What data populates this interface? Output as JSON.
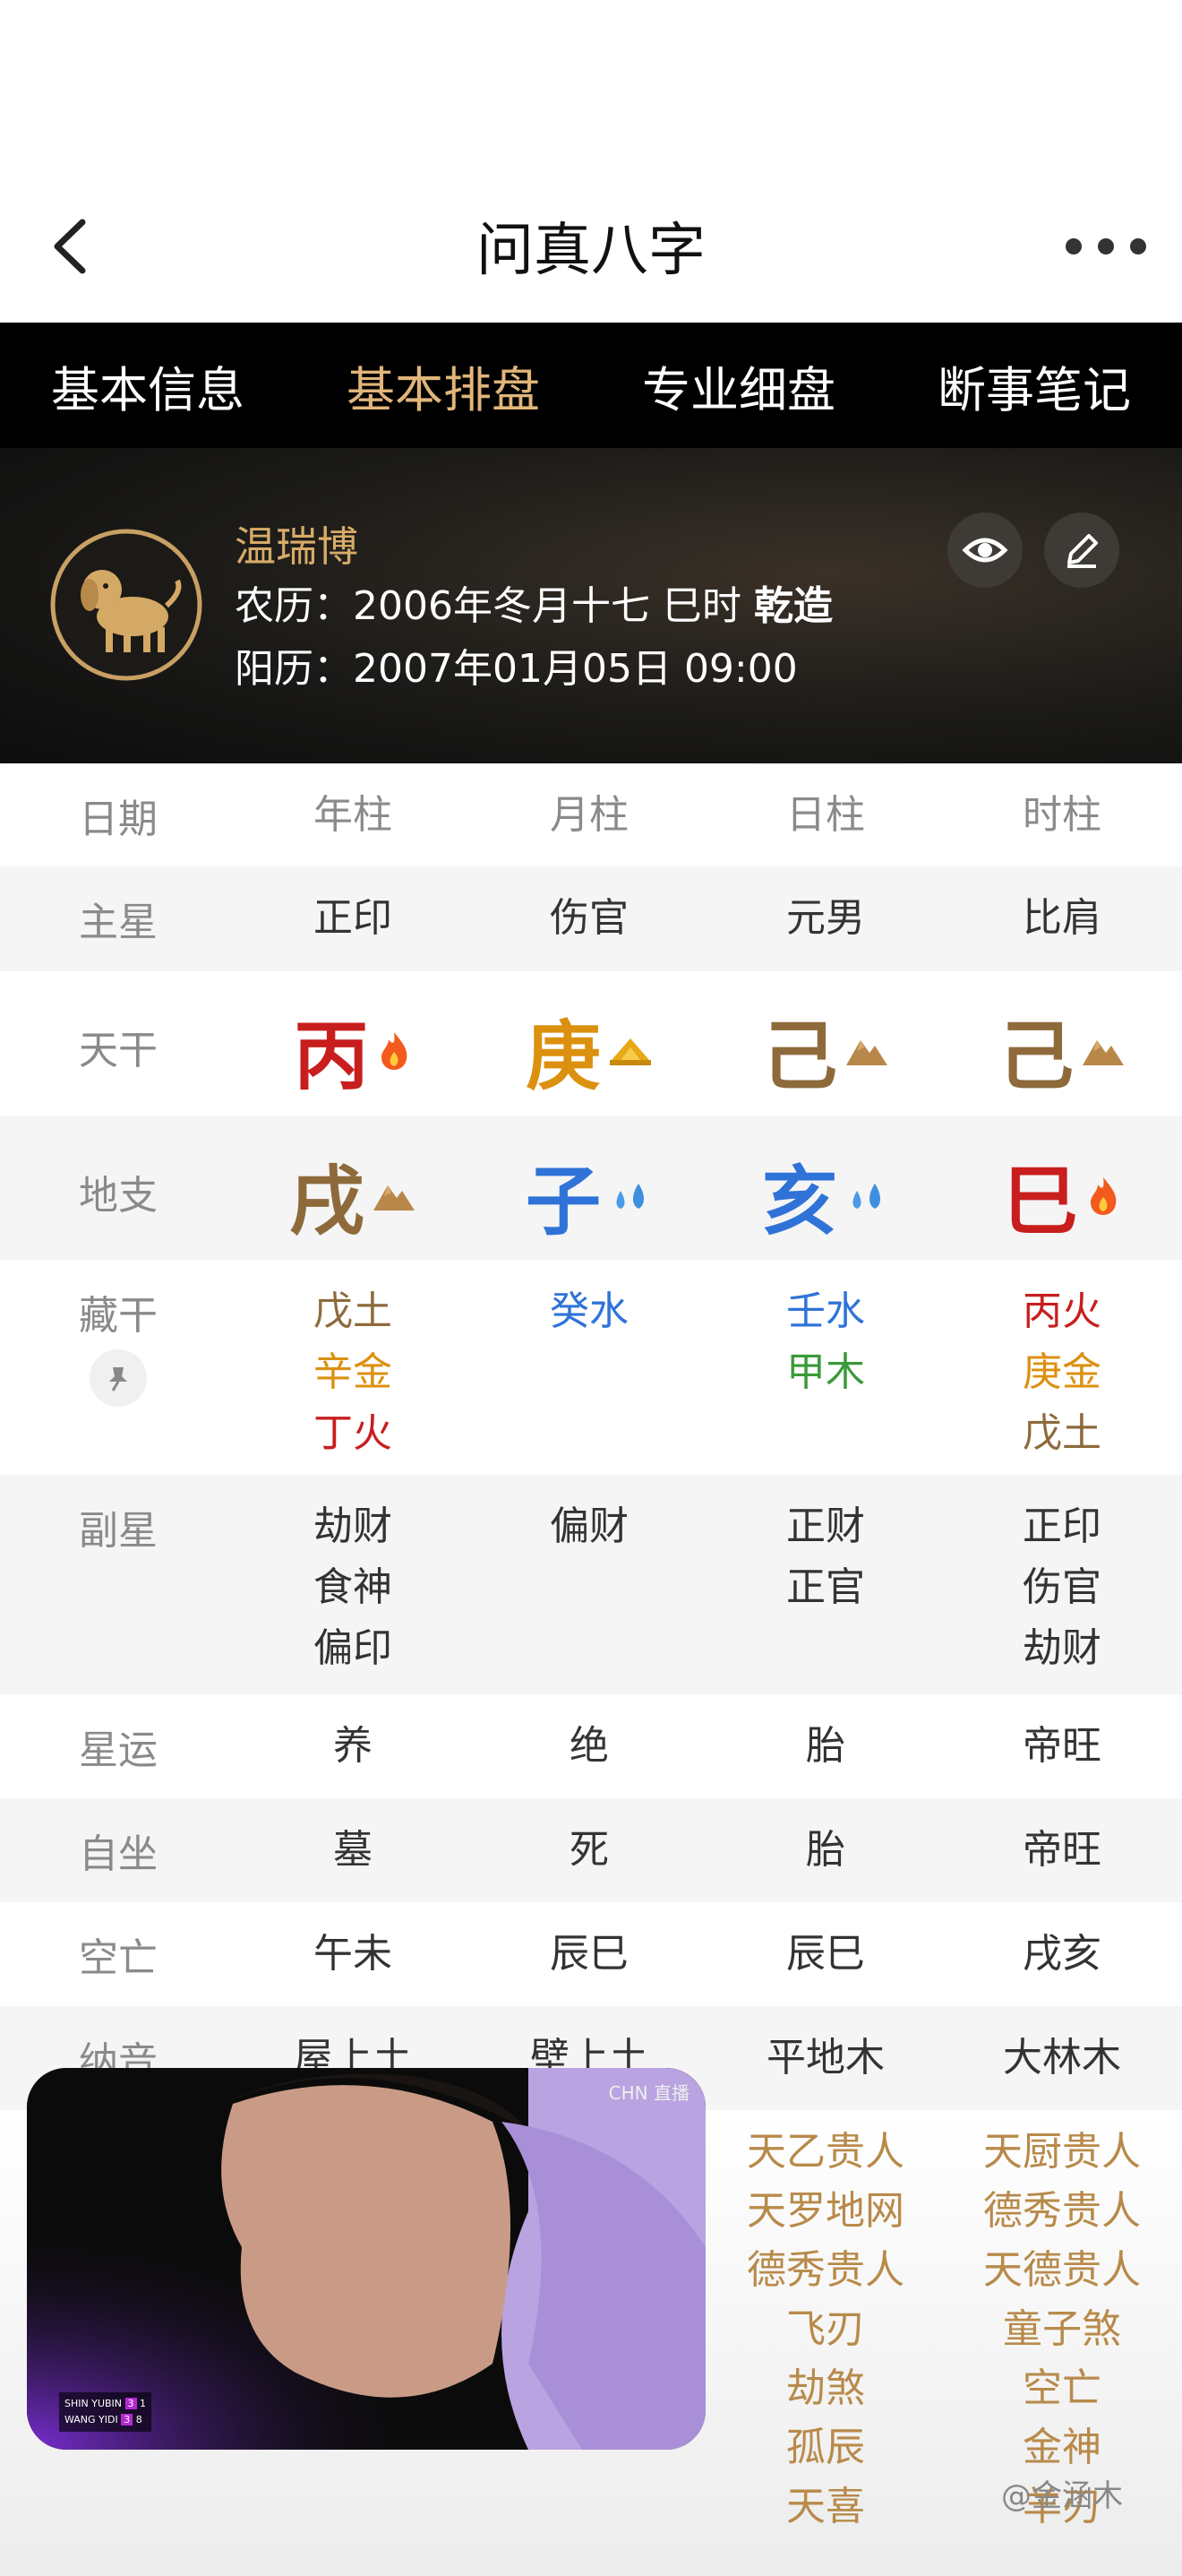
{
  "nav": {
    "title": "问真八字"
  },
  "tabs": [
    {
      "label": "基本信息"
    },
    {
      "label": "基本排盘"
    },
    {
      "label": "专业细盘"
    },
    {
      "label": "断事笔记"
    }
  ],
  "profile": {
    "name": "温瑞博",
    "lunar_label": "农历：",
    "lunar": "2006年冬月十七 巳时",
    "gender_tag": "乾造",
    "solar_label": "阳历：",
    "solar": "2007年01月05日 09:00"
  },
  "table": {
    "header": [
      "日期",
      "年柱",
      "月柱",
      "日柱",
      "时柱"
    ],
    "zhuxing": {
      "label": "主星",
      "values": [
        "正印",
        "伤官",
        "元男",
        "比肩"
      ]
    },
    "tiangan": {
      "label": "天干",
      "values": [
        "丙",
        "庚",
        "己",
        "己"
      ]
    },
    "dizhi": {
      "label": "地支",
      "values": [
        "戌",
        "子",
        "亥",
        "巳"
      ]
    },
    "canggan": {
      "label": "藏干",
      "year": [
        "戊土",
        "辛金",
        "丁火"
      ],
      "month": [
        "癸水"
      ],
      "day": [
        "壬水",
        "甲木"
      ],
      "hour": [
        "丙火",
        "庚金",
        "戊土"
      ]
    },
    "fuxing": {
      "label": "副星",
      "year": [
        "劫财",
        "食神",
        "偏印"
      ],
      "month": [
        "偏财"
      ],
      "day": [
        "正财",
        "正官"
      ],
      "hour": [
        "正印",
        "伤官",
        "劫财"
      ]
    },
    "xingyun": {
      "label": "星运",
      "values": [
        "养",
        "绝",
        "胎",
        "帝旺"
      ]
    },
    "zizuo": {
      "label": "自坐",
      "values": [
        "墓",
        "死",
        "胎",
        "帝旺"
      ]
    },
    "kongwang": {
      "label": "空亡",
      "values": [
        "午未",
        "辰巳",
        "辰巳",
        "戌亥"
      ]
    },
    "nayin": {
      "label": "纳音",
      "values": [
        "屋上土",
        "壁上土",
        "平地木",
        "大林木"
      ]
    },
    "shensha": {
      "day": [
        "天乙贵人",
        "天罗地网",
        "德秀贵人",
        "飞刃",
        "劫煞",
        "孤辰",
        "天喜"
      ],
      "hour": [
        "天厨贵人",
        "德秀贵人",
        "天德贵人",
        "童子煞",
        "空亡",
        "金神",
        "羊刃"
      ]
    }
  },
  "video": {
    "badge": "CHN 直播",
    "p1": "SHIN YUBIN",
    "p1_score": "3",
    "p1_game": "1",
    "p2": "WANG YIDI",
    "p2_score": "3",
    "p2_game": "8"
  },
  "watermark": "@金涵木",
  "colors": {
    "accent": "#e0b57a",
    "fire": "#c81e1e",
    "metal": "#dc900f",
    "earth": "#8e6a3b",
    "water": "#2f73d8",
    "wood": "#3a9a38"
  }
}
